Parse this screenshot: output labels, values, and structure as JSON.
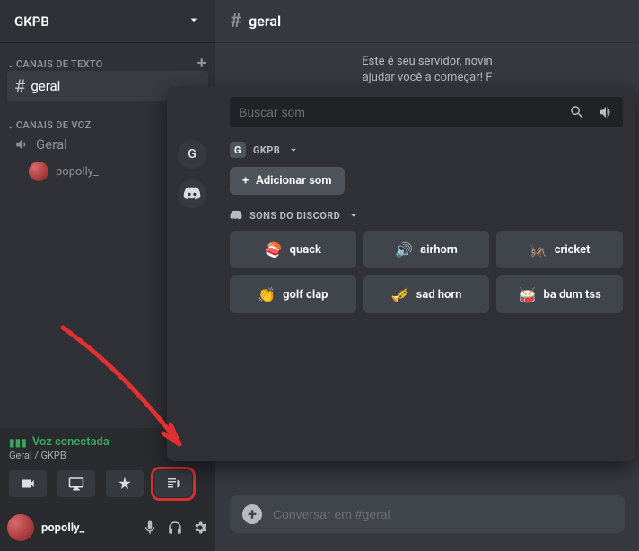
{
  "server": {
    "name": "GKPB"
  },
  "categories": {
    "text": {
      "label": "CANAIS DE TEXTO"
    },
    "voice": {
      "label": "CANAIS DE VOZ"
    }
  },
  "channels": {
    "text_geral": "geral",
    "voice_geral": "Geral"
  },
  "voice_users": {
    "u0": "popolly_"
  },
  "voice_panel": {
    "status": "Voz conectada",
    "sub": "Geral / GKPB"
  },
  "user": {
    "name": "popolly_"
  },
  "chat": {
    "header_channel": "geral",
    "welcome_line1": "Este é seu servidor, novin",
    "welcome_line2": "ajudar você a começar! F",
    "input_placeholder": "Conversar em #geral"
  },
  "soundboard": {
    "search_placeholder": "Buscar som",
    "rail_server_letter": "G",
    "section_server": {
      "badge": "G",
      "name": "GKPB"
    },
    "add_label": "Adicionar som",
    "section_discord": {
      "name": "SONS DO DISCORD"
    },
    "sounds": [
      {
        "emoji": "🍣",
        "name": "quack"
      },
      {
        "emoji": "🔊",
        "name": "airhorn"
      },
      {
        "emoji": "🦗",
        "name": "cricket"
      },
      {
        "emoji": "👏",
        "name": "golf clap"
      },
      {
        "emoji": "🎺",
        "name": "sad horn"
      },
      {
        "emoji": "🥁",
        "name": "ba dum tss"
      }
    ]
  }
}
